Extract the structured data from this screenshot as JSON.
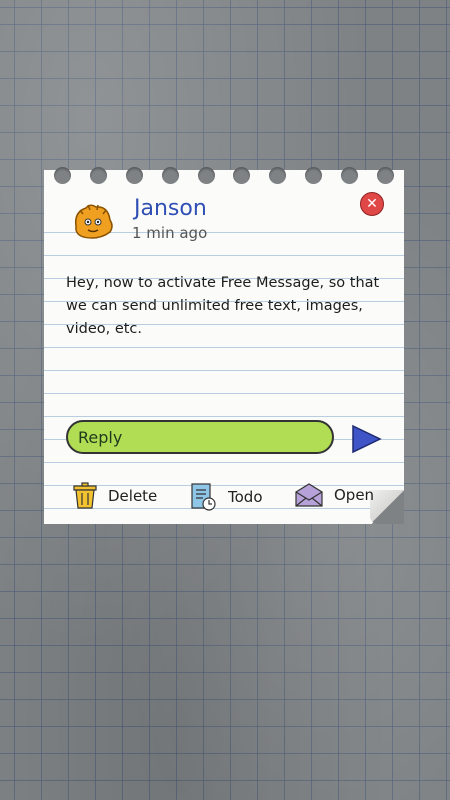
{
  "sender": {
    "name": "Janson",
    "time": "1 min ago"
  },
  "message": {
    "text": "Hey, now to activate Free Message, so that we can send unlimited free text, images, video, etc."
  },
  "reply": {
    "label": "Reply"
  },
  "actions": {
    "delete": "Delete",
    "todo": "Todo",
    "open": "Open"
  },
  "icons": {
    "avatar": "orange-monster-icon",
    "close": "close-icon",
    "send": "send-arrow-icon",
    "delete": "trash-icon",
    "todo": "clipboard-clock-icon",
    "open": "envelope-icon"
  },
  "colors": {
    "name": "#2f4fb5",
    "reply": "#b1dd54",
    "send": "#3f55c7",
    "close": "#e04848",
    "delete": "#f2c230"
  }
}
